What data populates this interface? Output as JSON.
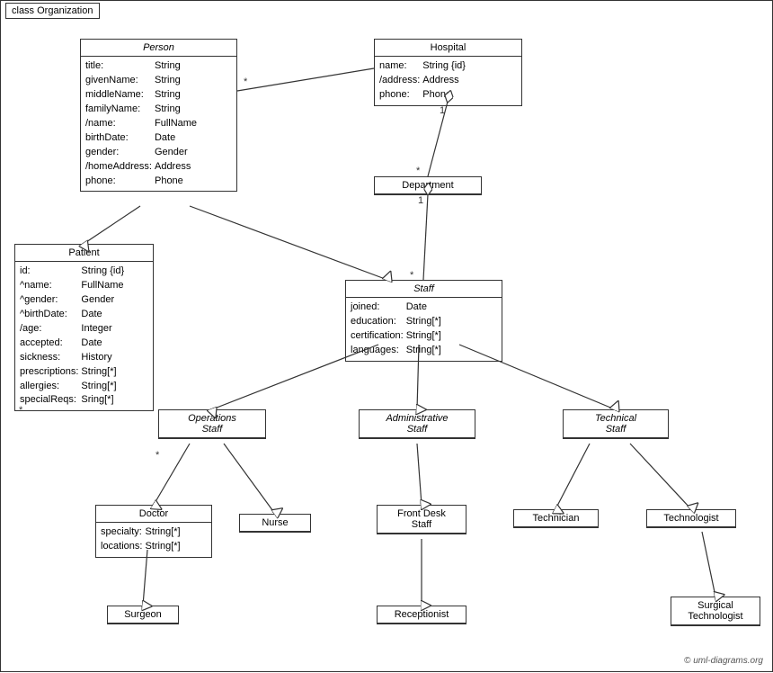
{
  "diagram": {
    "title": "class Organization",
    "copyright": "© uml-diagrams.org",
    "classes": {
      "person": {
        "name": "Person",
        "italic": true,
        "attrs": [
          [
            "title:",
            "String"
          ],
          [
            "givenName:",
            "String"
          ],
          [
            "middleName:",
            "String"
          ],
          [
            "familyName:",
            "String"
          ],
          [
            "/name:",
            "FullName"
          ],
          [
            "birthDate:",
            "Date"
          ],
          [
            "gender:",
            "Gender"
          ],
          [
            "/homeAddress:",
            "Address"
          ],
          [
            "phone:",
            "Phone"
          ]
        ]
      },
      "hospital": {
        "name": "Hospital",
        "italic": false,
        "attrs": [
          [
            "name:",
            "String {id}"
          ],
          [
            "/address:",
            "Address"
          ],
          [
            "phone:",
            "Phone"
          ]
        ]
      },
      "patient": {
        "name": "Patient",
        "italic": false,
        "attrs": [
          [
            "id:",
            "String {id}"
          ],
          [
            "^name:",
            "FullName"
          ],
          [
            "^gender:",
            "Gender"
          ],
          [
            "^birthDate:",
            "Date"
          ],
          [
            "/age:",
            "Integer"
          ],
          [
            "accepted:",
            "Date"
          ],
          [
            "sickness:",
            "History"
          ],
          [
            "prescriptions:",
            "String[*]"
          ],
          [
            "allergies:",
            "String[*]"
          ],
          [
            "specialReqs:",
            "Sring[*]"
          ]
        ]
      },
      "department": {
        "name": "Department",
        "italic": false,
        "attrs": []
      },
      "staff": {
        "name": "Staff",
        "italic": true,
        "attrs": [
          [
            "joined:",
            "Date"
          ],
          [
            "education:",
            "String[*]"
          ],
          [
            "certification:",
            "String[*]"
          ],
          [
            "languages:",
            "String[*]"
          ]
        ]
      },
      "operations_staff": {
        "name": "Operations\nStaff",
        "italic": true,
        "attrs": []
      },
      "administrative_staff": {
        "name": "Administrative\nStaff",
        "italic": true,
        "attrs": []
      },
      "technical_staff": {
        "name": "Technical\nStaff",
        "italic": true,
        "attrs": []
      },
      "doctor": {
        "name": "Doctor",
        "italic": false,
        "attrs": [
          [
            "specialty:",
            "String[*]"
          ],
          [
            "locations:",
            "String[*]"
          ]
        ]
      },
      "nurse": {
        "name": "Nurse",
        "italic": false,
        "attrs": []
      },
      "front_desk_staff": {
        "name": "Front Desk\nStaff",
        "italic": false,
        "attrs": []
      },
      "technician": {
        "name": "Technician",
        "italic": false,
        "attrs": []
      },
      "technologist": {
        "name": "Technologist",
        "italic": false,
        "attrs": []
      },
      "surgeon": {
        "name": "Surgeon",
        "italic": false,
        "attrs": []
      },
      "receptionist": {
        "name": "Receptionist",
        "italic": false,
        "attrs": []
      },
      "surgical_technologist": {
        "name": "Surgical\nTechnologist",
        "italic": false,
        "attrs": []
      }
    }
  }
}
